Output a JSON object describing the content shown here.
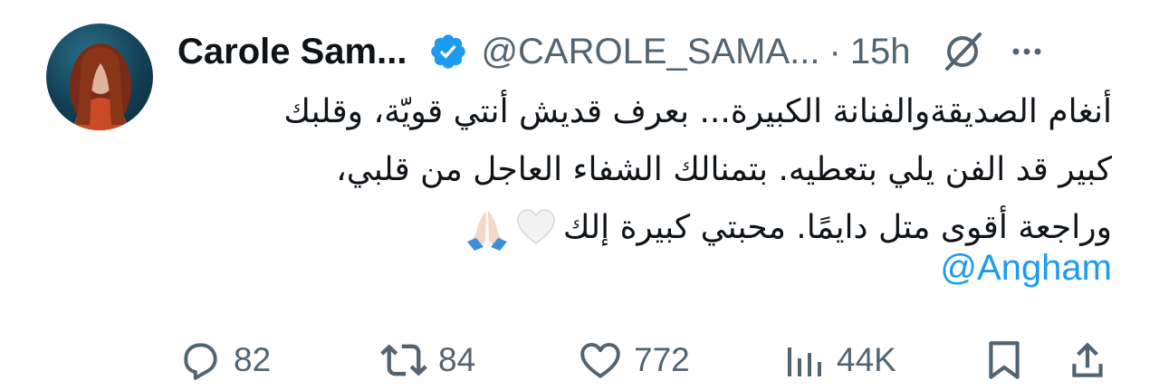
{
  "tweet": {
    "author_name": "Carole Sam...",
    "handle": "@CAROLE_SAMA...",
    "separator": "·",
    "time": "15h",
    "lines": [
      "أنغام الصديقةوالفنانة الكبيرة... بعرف قديش أنتي قويّة، وقلبك",
      "كبير قد الفن يلي بتعطيه. بتمنالك الشفاء العاجل من قلبي،",
      "وراجعة أقوى متل دايمًا. محبتي كبيرة إلك"
    ],
    "mention": "@Angham"
  },
  "actions": {
    "replies": "82",
    "reposts": "84",
    "likes": "772",
    "views": "44K"
  },
  "icons": {
    "verified_color": "#1d9bf0",
    "muted_color": "#536471",
    "link_color": "#1d9bf0"
  }
}
